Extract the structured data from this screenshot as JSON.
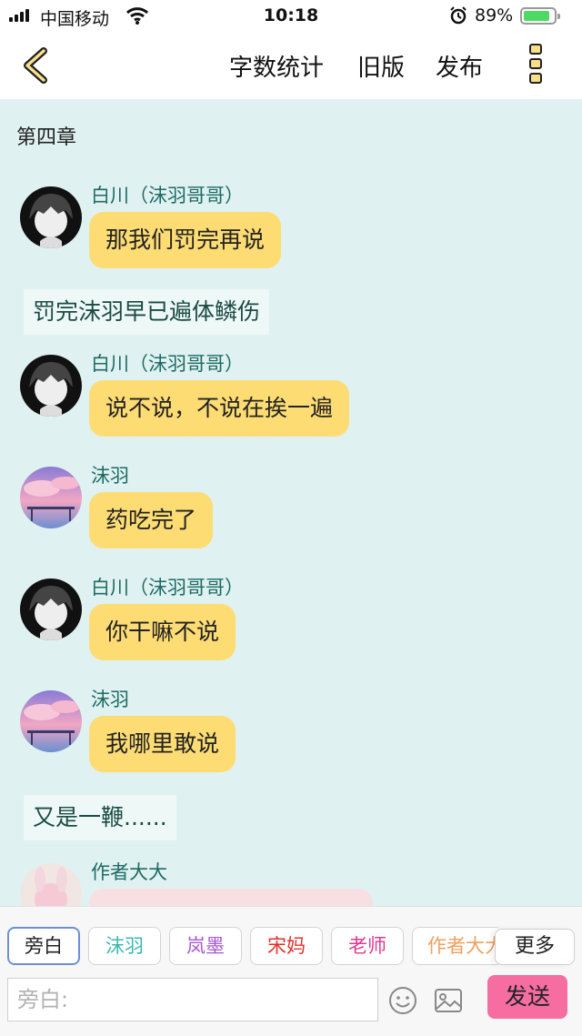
{
  "status_bar": {
    "carrier": "中国移动",
    "time": "10:18",
    "battery_percent": "89%",
    "battery_level": 0.89
  },
  "nav": {
    "word_count": "字数统计",
    "old_version": "旧版",
    "publish": "发布"
  },
  "chapter_title": "第四章",
  "messages": [
    {
      "type": "dialogue",
      "sender": "白川（沫羽哥哥）",
      "text": "那我们罚完再说",
      "avatar": "boy-avatar-icon"
    },
    {
      "type": "narration",
      "text": "罚完沫羽早已遍体鳞伤"
    },
    {
      "type": "dialogue",
      "sender": "白川（沫羽哥哥）",
      "text": "说不说，不说在挨一遍",
      "avatar": "boy-avatar-icon"
    },
    {
      "type": "dialogue",
      "sender": "沫羽",
      "text": "药吃完了",
      "avatar": "sunset-avatar-icon"
    },
    {
      "type": "dialogue",
      "sender": "白川（沫羽哥哥）",
      "text": "你干嘛不说",
      "avatar": "boy-avatar-icon"
    },
    {
      "type": "dialogue",
      "sender": "沫羽",
      "text": "我哪里敢说",
      "avatar": "sunset-avatar-icon"
    },
    {
      "type": "narration",
      "text": "又是一鞭......"
    },
    {
      "type": "dialogue",
      "sender": "作者大大",
      "text": "",
      "avatar": "author-avatar-icon"
    }
  ],
  "roles": [
    {
      "label": "旁白",
      "color": "#222222",
      "active": true
    },
    {
      "label": "沫羽",
      "color": "#3bb8b0"
    },
    {
      "label": "岚墨",
      "color": "#a35ad1"
    },
    {
      "label": "宋妈",
      "color": "#e0312a"
    },
    {
      "label": "老师",
      "color": "#e0388f"
    },
    {
      "label": "作者大大",
      "color": "#f0a060"
    }
  ],
  "more_label": "更多",
  "input": {
    "placeholder": "旁白:"
  },
  "send_label": "发送",
  "colors": {
    "background": "#dff1f1",
    "bubble": "#fddc74",
    "sender_text": "#1e6b64",
    "send_button": "#f66da1"
  }
}
